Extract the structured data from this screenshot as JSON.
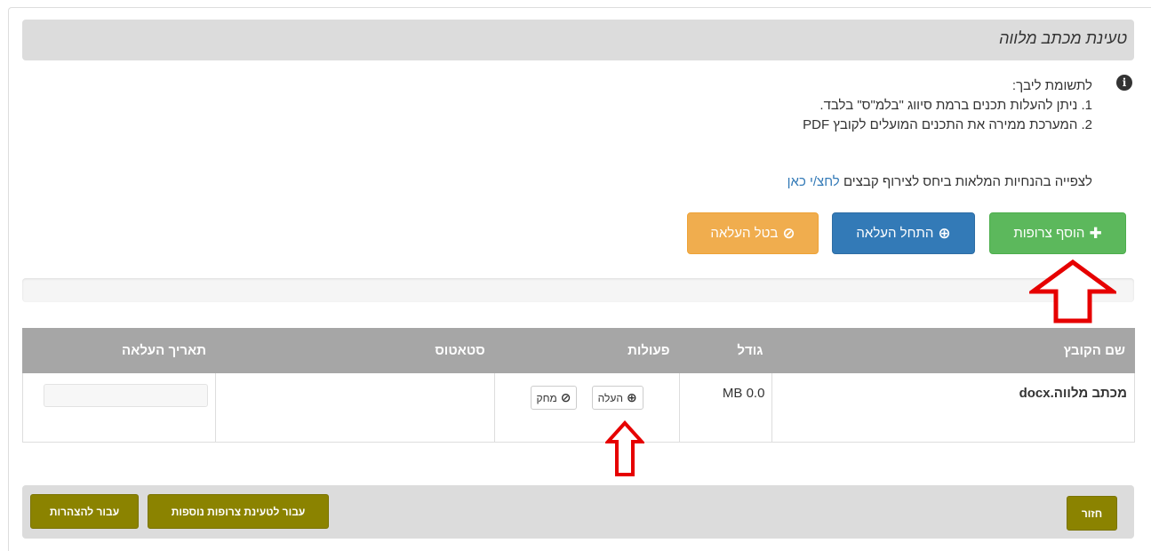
{
  "panel": {
    "title": "טעינת מכתב מלווה"
  },
  "notice": {
    "heading": "לתשומת ליבך:",
    "items": [
      "1. ניתן להעלות תכנים ברמת סיווג \"בלמ\"ס\" בלבד.",
      "2. המערכת ממירה את התכנים המועלים לקובץ PDF"
    ],
    "guide_text": "לצפייה בהנחיות המלאות ביחס לצירוף קבצים",
    "guide_link": "לחצ/י כאן"
  },
  "toolbar": {
    "add_label": "הוסף צרופות",
    "start_label": "התחל העלאה",
    "cancel_label": "בטל העלאה"
  },
  "table": {
    "headers": {
      "name": "שם הקובץ",
      "size": "גודל",
      "actions": "פעולות",
      "status": "סטאטוס",
      "date": "תאריך העלאה"
    },
    "rows": [
      {
        "name": "מכתב מלווה.docx",
        "size": "0.0 MB",
        "upload_label": "העלה",
        "delete_label": "מחק",
        "status": "",
        "date": ""
      }
    ]
  },
  "footer": {
    "back_label": "חזור",
    "more_label": "עבור לטעינת צרופות נוספות",
    "declarations_label": "עבור להצהרות"
  },
  "colors": {
    "green": "#5cb85c",
    "blue": "#337ab7",
    "orange": "#f0ad4e",
    "olive": "#8b8300",
    "annotation_red": "#e60000"
  },
  "icons": {
    "info": "info-circle-icon",
    "add": "plus-icon",
    "start": "upload-circle-icon",
    "cancel": "ban-icon"
  }
}
